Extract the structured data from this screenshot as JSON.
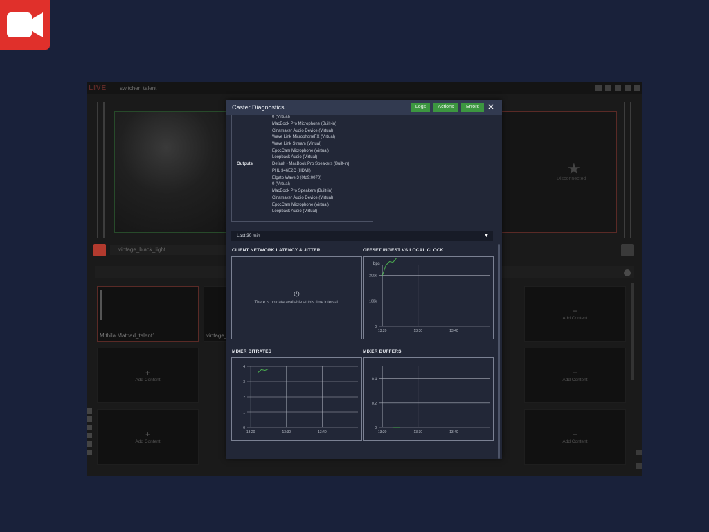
{
  "brand": {
    "logo_icon": "video-camera-icon",
    "logo_color": "#e0302b"
  },
  "app": {
    "brand_text": "LIVE",
    "title": "switcher_talent",
    "program_status": "Disconnected",
    "preview_source": "vintage_black_light",
    "tiles": {
      "talent1": "Mithila Mathad_talent1",
      "talent2": "vintage_",
      "add_content": "Add Content",
      "plus": "+"
    }
  },
  "modal": {
    "title": "Caster Diagnostics",
    "buttons": {
      "logs": "Logs",
      "actions": "Actions",
      "errors": "Errors"
    },
    "close_glyph": "✕",
    "devices": {
      "inputs_tail": [
        "0 (Virtual)",
        "MacBook Pro Microphone (Built-in)",
        "Cinamaker Audio Device (Virtual)",
        "Wave Link MicrophoneFX (Virtual)",
        "Wave Link Stream (Virtual)",
        "EpocCam Microphone (Virtual)",
        "Loopback Audio (Virtual)"
      ],
      "outputs_label": "Outputs",
      "outputs": [
        "Default - MacBook Pro Speakers (Built-in)",
        "PHL 346E2C (HDMI)",
        "Elgato Wave:3 (0fd9:0070)",
        "0 (Virtual)",
        "MacBook Pro Speakers (Built-in)",
        "Cinamaker Audio Device (Virtual)",
        "EpocCam Microphone (Virtual)",
        "Loopback Audio (Virtual)"
      ]
    },
    "time_range": {
      "selected": "Last 30 min",
      "caret": "▼"
    },
    "sections": {
      "latency": {
        "title": "CLIENT NETWORK LATENCY & JITTER",
        "nodata_icon": "clock-icon",
        "nodata_glyph": "◷",
        "nodata_text": "There is no data available at this time interval."
      },
      "offset": {
        "title": "OFFSET INGEST VS LOCAL CLOCK"
      },
      "bitrates": {
        "title": "MIXER BITRATES"
      },
      "buffers": {
        "title": "MIXER BUFFERS"
      }
    }
  },
  "chart_data": [
    {
      "type": "line",
      "title": "OFFSET INGEST VS LOCAL CLOCK",
      "ylabel": "bps",
      "xticks": [
        "13:20",
        "13:30",
        "13:40"
      ],
      "yticks": [
        "0",
        "100k",
        "200k"
      ],
      "ylim": [
        0,
        240000
      ],
      "xlim": [
        "13:19",
        "13:50"
      ],
      "series": [
        {
          "color": "#4caf50",
          "x": [
            "13:20",
            "13:21",
            "13:22",
            "13:23",
            "13:24"
          ],
          "values": [
            200000,
            240000,
            255000,
            252000,
            270000
          ]
        }
      ],
      "grid": true
    },
    {
      "type": "line",
      "title": "MIXER BITRATES",
      "xticks": [
        "13:20",
        "13:30",
        "13:40"
      ],
      "yticks": [
        "0",
        "1",
        "2",
        "3",
        "4"
      ],
      "ylim": [
        0,
        4
      ],
      "xlim": [
        "13:19",
        "13:50"
      ],
      "series": [
        {
          "color": "#4caf50",
          "x": [
            "13:22",
            "13:23",
            "13:24",
            "13:25"
          ],
          "values": [
            3.6,
            3.8,
            3.75,
            3.85
          ]
        }
      ],
      "grid": true
    },
    {
      "type": "line",
      "title": "MIXER BUFFERS",
      "xticks": [
        "13:20",
        "13:30",
        "13:40"
      ],
      "yticks": [
        "0",
        "0.2",
        "0.4"
      ],
      "ylim": [
        0,
        0.5
      ],
      "xlim": [
        "13:19",
        "13:50"
      ],
      "series": [
        {
          "color": "#4caf50",
          "x": [
            "13:23",
            "13:24",
            "13:25"
          ],
          "values": [
            0,
            0,
            0
          ]
        }
      ],
      "grid": true
    }
  ]
}
